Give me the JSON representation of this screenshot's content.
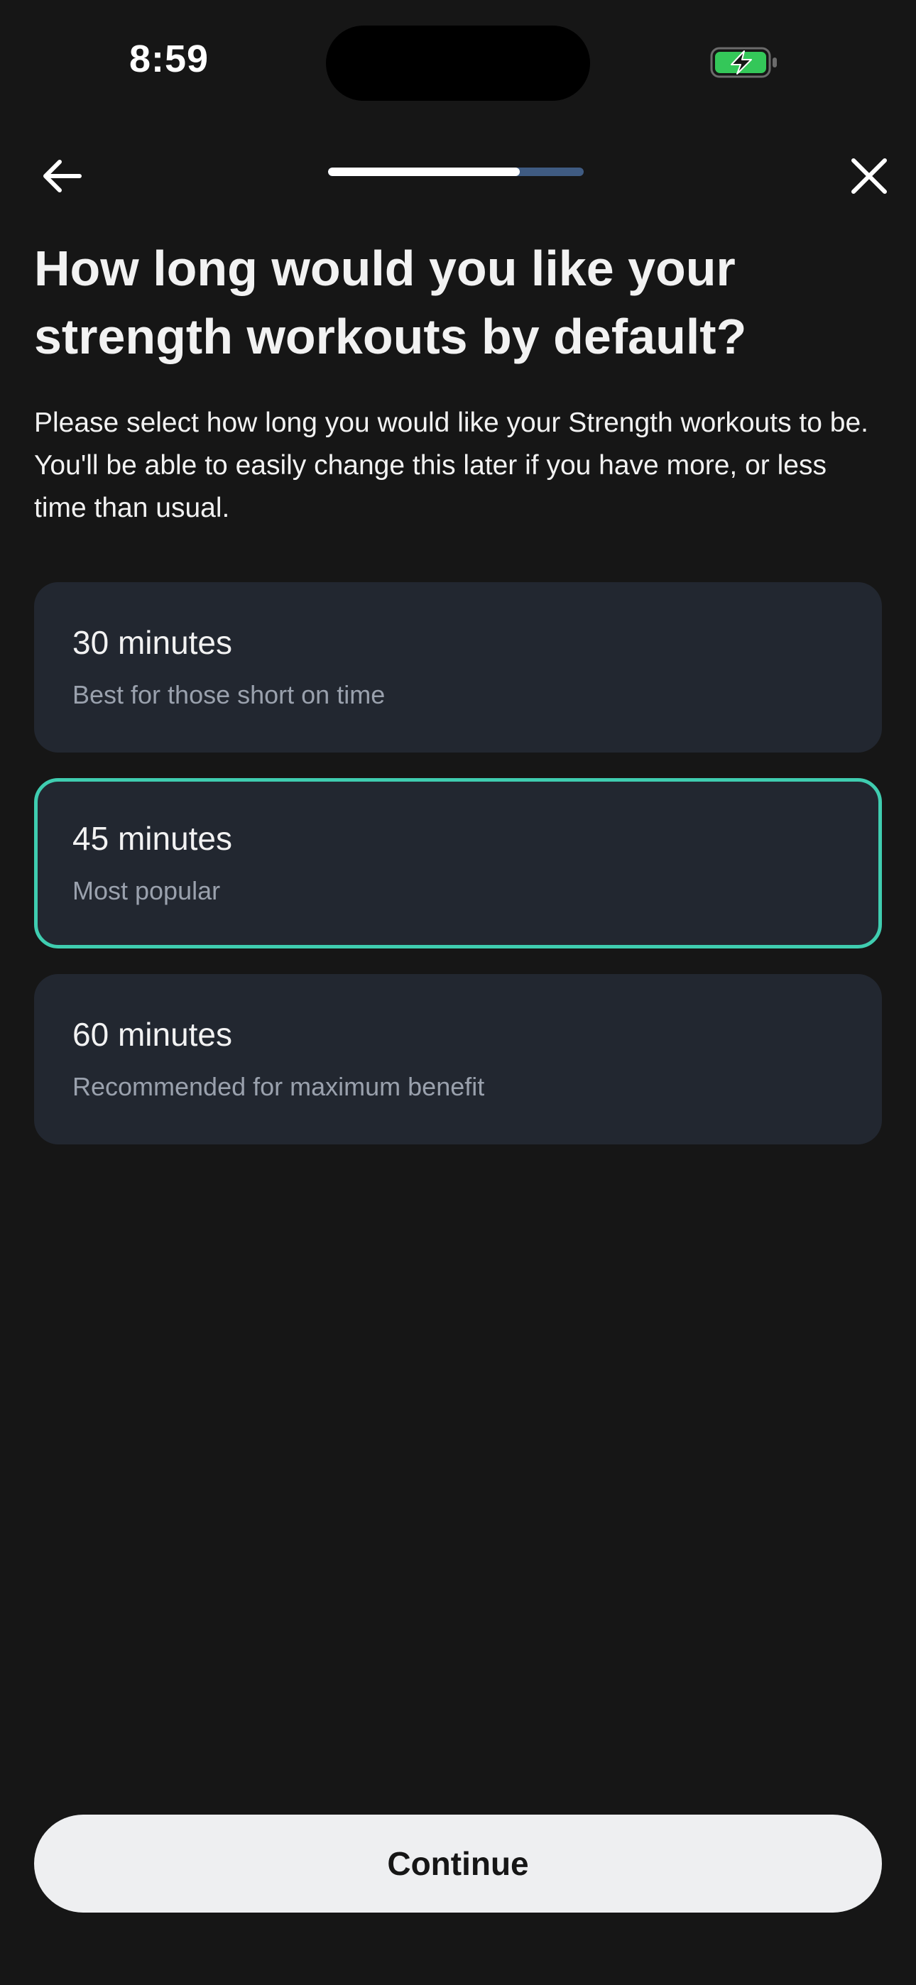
{
  "status_bar": {
    "time": "8:59",
    "battery_icon": "battery-charging-icon",
    "battery_color": "#34c759"
  },
  "header": {
    "back_icon": "arrow-left-icon",
    "close_icon": "close-icon",
    "progress_fraction": 0.75
  },
  "question": {
    "title": "How long would you like your strength workouts by default?",
    "description": "Please select how long you would like your Strength workouts to be. You'll be able to easily change this later if you have more, or less time than usual."
  },
  "options": [
    {
      "title": "30 minutes",
      "subtitle": "Best for those short on time",
      "selected": false
    },
    {
      "title": "45 minutes",
      "subtitle": "Most popular",
      "selected": true
    },
    {
      "title": "60 minutes",
      "subtitle": "Recommended for maximum benefit",
      "selected": false
    }
  ],
  "continue_label": "Continue",
  "colors": {
    "background": "#161616",
    "card": "#222730",
    "selected_border": "#3fcdb0",
    "progress_track": "#3f5b82",
    "button_bg": "#eeeff1"
  }
}
